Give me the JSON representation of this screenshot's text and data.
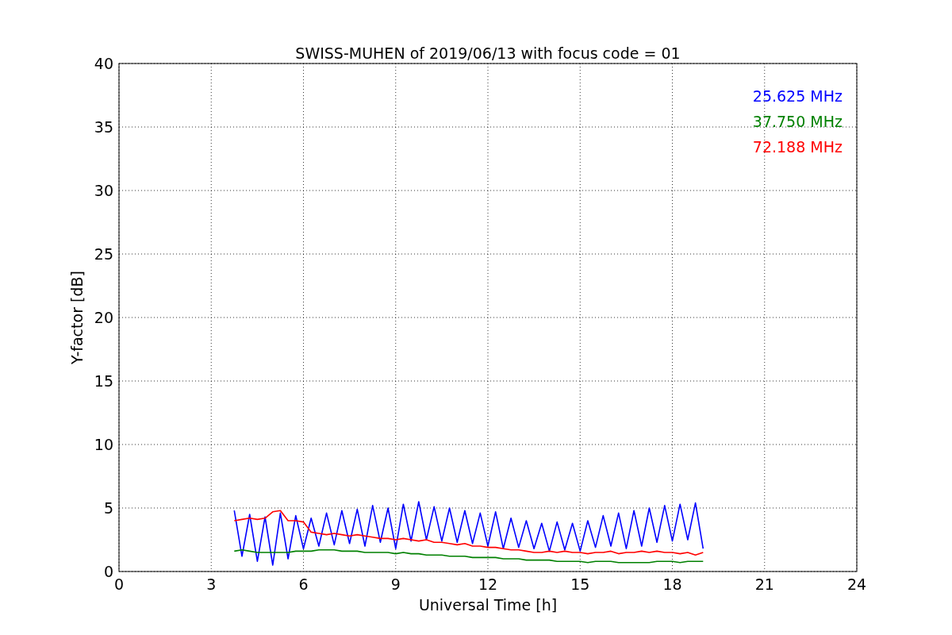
{
  "figure": {
    "chart_data": {
      "type": "line",
      "title": "SWISS-MUHEN of 2019/06/13 with focus code = 01",
      "xlabel": "Universal Time [h]",
      "ylabel": "Y-factor [dB]",
      "x": [
        3.75,
        4.0,
        4.25,
        4.5,
        4.75,
        5.0,
        5.25,
        5.5,
        5.75,
        6.0,
        6.25,
        6.5,
        6.75,
        7.0,
        7.25,
        7.5,
        7.75,
        8.0,
        8.25,
        8.5,
        8.75,
        9.0,
        9.25,
        9.5,
        9.75,
        10.0,
        10.25,
        10.5,
        10.75,
        11.0,
        11.25,
        11.5,
        11.75,
        12.0,
        12.25,
        12.5,
        12.75,
        13.0,
        13.25,
        13.5,
        13.75,
        14.0,
        14.25,
        14.5,
        14.75,
        15.0,
        15.25,
        15.5,
        15.75,
        16.0,
        16.25,
        16.5,
        16.75,
        17.0,
        17.25,
        17.5,
        17.75,
        18.0,
        18.25,
        18.5,
        18.75,
        19.0
      ],
      "series": [
        {
          "name": "25.625 MHz",
          "color": "#0000ff",
          "values": [
            4.8,
            1.2,
            4.5,
            0.8,
            4.3,
            0.5,
            4.6,
            1.0,
            4.4,
            1.8,
            4.2,
            2.0,
            4.6,
            2.1,
            4.8,
            2.2,
            4.9,
            2.0,
            5.2,
            2.3,
            5.0,
            1.8,
            5.3,
            2.4,
            5.5,
            2.5,
            5.1,
            2.4,
            5.0,
            2.3,
            4.8,
            2.2,
            4.6,
            2.0,
            4.7,
            1.8,
            4.2,
            1.9,
            4.0,
            1.8,
            3.8,
            1.6,
            3.9,
            1.7,
            3.8,
            1.6,
            4.0,
            1.9,
            4.4,
            2.0,
            4.6,
            1.8,
            4.8,
            2.0,
            5.0,
            2.3,
            5.2,
            2.4,
            5.3,
            2.5,
            5.4,
            1.8
          ]
        },
        {
          "name": "37.750 MHz",
          "color": "#008000",
          "values": [
            1.6,
            1.7,
            1.6,
            1.5,
            1.5,
            1.5,
            1.5,
            1.5,
            1.6,
            1.6,
            1.6,
            1.7,
            1.7,
            1.7,
            1.6,
            1.6,
            1.6,
            1.5,
            1.5,
            1.5,
            1.5,
            1.4,
            1.5,
            1.4,
            1.4,
            1.3,
            1.3,
            1.3,
            1.2,
            1.2,
            1.2,
            1.1,
            1.1,
            1.1,
            1.1,
            1.0,
            1.0,
            1.0,
            0.9,
            0.9,
            0.9,
            0.9,
            0.8,
            0.8,
            0.8,
            0.8,
            0.7,
            0.8,
            0.8,
            0.8,
            0.7,
            0.7,
            0.7,
            0.7,
            0.7,
            0.8,
            0.8,
            0.8,
            0.7,
            0.8,
            0.8,
            0.8
          ]
        },
        {
          "name": "72.188 MHz",
          "color": "#ff0000",
          "values": [
            4.0,
            4.1,
            4.2,
            4.1,
            4.2,
            4.7,
            4.8,
            4.0,
            4.0,
            3.9,
            3.1,
            3.0,
            2.9,
            3.0,
            2.9,
            2.8,
            2.9,
            2.8,
            2.7,
            2.6,
            2.6,
            2.5,
            2.6,
            2.5,
            2.4,
            2.5,
            2.3,
            2.3,
            2.2,
            2.1,
            2.2,
            2.0,
            2.0,
            1.9,
            1.9,
            1.8,
            1.7,
            1.7,
            1.6,
            1.5,
            1.5,
            1.6,
            1.5,
            1.6,
            1.5,
            1.5,
            1.4,
            1.5,
            1.5,
            1.6,
            1.4,
            1.5,
            1.5,
            1.6,
            1.5,
            1.6,
            1.5,
            1.5,
            1.4,
            1.5,
            1.3,
            1.5
          ]
        }
      ],
      "xlim": [
        0,
        24
      ],
      "ylim": [
        0,
        40
      ],
      "xticks": [
        0,
        3,
        6,
        9,
        12,
        15,
        18,
        21,
        24
      ],
      "yticks": [
        0,
        5,
        10,
        15,
        20,
        25,
        30,
        35,
        40
      ],
      "grid": true
    }
  }
}
